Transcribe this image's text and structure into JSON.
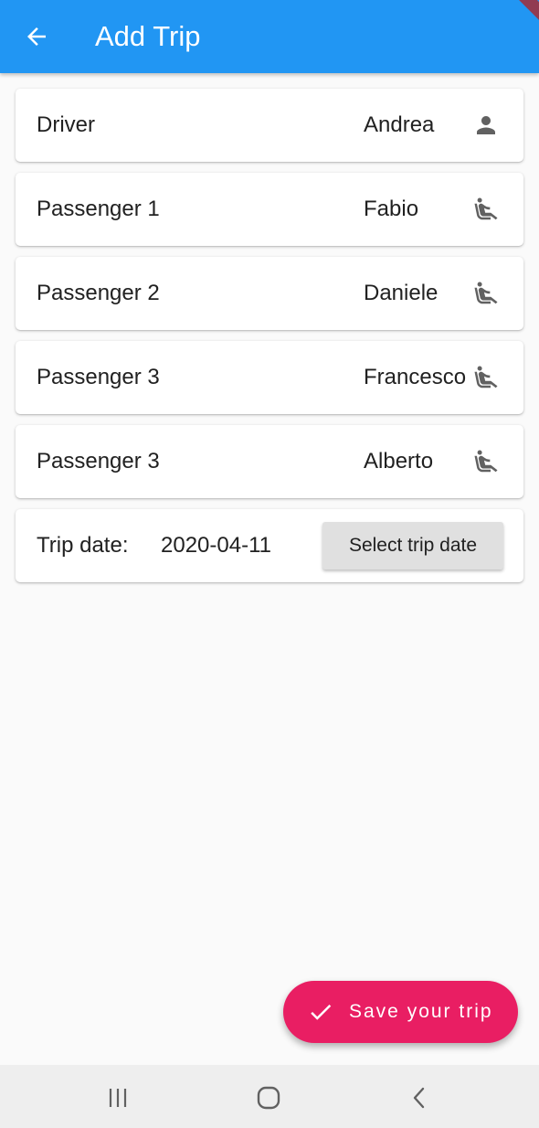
{
  "app_bar": {
    "title": "Add Trip",
    "back_icon": "arrow-back-icon",
    "color": "#2196f3"
  },
  "people": [
    {
      "role": "Driver",
      "name": "Andrea",
      "icon": "person-icon"
    },
    {
      "role": "Passenger 1",
      "name": "Fabio",
      "icon": "seat-icon"
    },
    {
      "role": "Passenger 2",
      "name": "Daniele",
      "icon": "seat-icon"
    },
    {
      "role": "Passenger 3",
      "name": "Francesco",
      "icon": "seat-icon"
    },
    {
      "role": "Passenger 3",
      "name": "Alberto",
      "icon": "seat-icon"
    }
  ],
  "trip_date": {
    "label": "Trip date:",
    "value": "2020-04-11",
    "button_label": "Select trip date"
  },
  "fab": {
    "label": "Save your trip",
    "icon": "check-icon",
    "color": "#e91e63"
  },
  "system_nav": {
    "recents_icon": "recents-icon",
    "home_icon": "home-icon",
    "back_icon": "nav-back-icon"
  }
}
